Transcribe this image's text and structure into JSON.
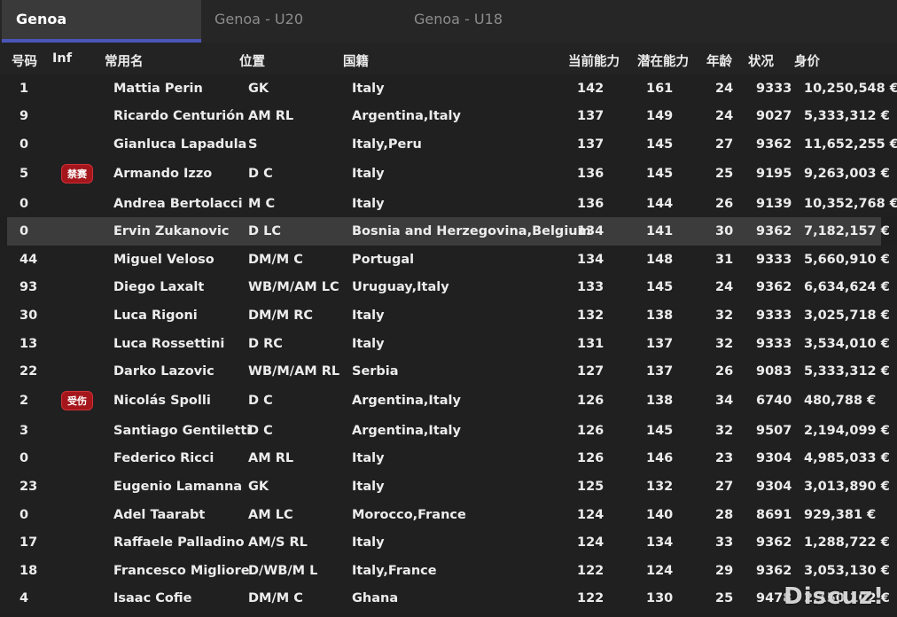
{
  "tabs": [
    {
      "label": "Genoa",
      "active": true
    },
    {
      "label": "Genoa - U20",
      "active": false
    },
    {
      "label": "Genoa - U18",
      "active": false
    }
  ],
  "columns": {
    "num": "号码",
    "inf": "Inf",
    "name": "常用名",
    "position": "位置",
    "nationality": "国籍",
    "current_ability": "当前能力",
    "potential_ability": "潜在能力",
    "age": "年龄",
    "condition": "状况",
    "value": "身价"
  },
  "players": [
    {
      "num": "1",
      "inf": "",
      "name": "Mattia Perin",
      "position": "GK",
      "nationality": "Italy",
      "ca": "142",
      "pa": "161",
      "age": "24",
      "condition": "9333",
      "value": "10,250,548 €"
    },
    {
      "num": "9",
      "inf": "",
      "name": "Ricardo Centurión",
      "position": "AM RL",
      "nationality": "Argentina,Italy",
      "ca": "137",
      "pa": "149",
      "age": "24",
      "condition": "9027",
      "value": "5,333,312 €"
    },
    {
      "num": "0",
      "inf": "",
      "name": "Gianluca Lapadula",
      "position": "S",
      "nationality": "Italy,Peru",
      "ca": "137",
      "pa": "145",
      "age": "27",
      "condition": "9362",
      "value": "11,652,255 €"
    },
    {
      "num": "5",
      "inf": "禁赛",
      "name": "Armando Izzo",
      "position": "D C",
      "nationality": "Italy",
      "ca": "136",
      "pa": "145",
      "age": "25",
      "condition": "9195",
      "value": "9,263,003 €"
    },
    {
      "num": "0",
      "inf": "",
      "name": "Andrea Bertolacci",
      "position": "M C",
      "nationality": "Italy",
      "ca": "136",
      "pa": "144",
      "age": "26",
      "condition": "9139",
      "value": "10,352,768 €"
    },
    {
      "num": "0",
      "inf": "",
      "name": "Ervin Zukanovic",
      "position": "D LC",
      "nationality": "Bosnia and Herzegovina,Belgium",
      "ca": "134",
      "pa": "141",
      "age": "30",
      "condition": "9362",
      "value": "7,182,157 €",
      "selected": true
    },
    {
      "num": "44",
      "inf": "",
      "name": "Miguel Veloso",
      "position": "DM/M C",
      "nationality": "Portugal",
      "ca": "134",
      "pa": "148",
      "age": "31",
      "condition": "9333",
      "value": "5,660,910 €"
    },
    {
      "num": "93",
      "inf": "",
      "name": "Diego Laxalt",
      "position": "WB/M/AM LC",
      "nationality": "Uruguay,Italy",
      "ca": "133",
      "pa": "145",
      "age": "24",
      "condition": "9362",
      "value": "6,634,624 €"
    },
    {
      "num": "30",
      "inf": "",
      "name": "Luca Rigoni",
      "position": "DM/M RC",
      "nationality": "Italy",
      "ca": "132",
      "pa": "138",
      "age": "32",
      "condition": "9333",
      "value": "3,025,718 €"
    },
    {
      "num": "13",
      "inf": "",
      "name": "Luca Rossettini",
      "position": "D RC",
      "nationality": "Italy",
      "ca": "131",
      "pa": "137",
      "age": "32",
      "condition": "9333",
      "value": "3,534,010 €"
    },
    {
      "num": "22",
      "inf": "",
      "name": "Darko Lazovic",
      "position": "WB/M/AM RL",
      "nationality": "Serbia",
      "ca": "127",
      "pa": "137",
      "age": "26",
      "condition": "9083",
      "value": "5,333,312 €"
    },
    {
      "num": "2",
      "inf": "受伤",
      "name": "Nicolás Spolli",
      "position": "D C",
      "nationality": "Argentina,Italy",
      "ca": "126",
      "pa": "138",
      "age": "34",
      "condition": "6740",
      "value": "480,788 €"
    },
    {
      "num": "3",
      "inf": "",
      "name": "Santiago Gentiletti",
      "position": "D C",
      "nationality": "Argentina,Italy",
      "ca": "126",
      "pa": "145",
      "age": "32",
      "condition": "9507",
      "value": "2,194,099 €"
    },
    {
      "num": "0",
      "inf": "",
      "name": "Federico Ricci",
      "position": "AM RL",
      "nationality": "Italy",
      "ca": "126",
      "pa": "146",
      "age": "23",
      "condition": "9304",
      "value": "4,985,033 €"
    },
    {
      "num": "23",
      "inf": "",
      "name": "Eugenio Lamanna",
      "position": "GK",
      "nationality": "Italy",
      "ca": "125",
      "pa": "132",
      "age": "27",
      "condition": "9304",
      "value": "3,013,890 €"
    },
    {
      "num": "0",
      "inf": "",
      "name": "Adel Taarabt",
      "position": "AM LC",
      "nationality": "Morocco,France",
      "ca": "124",
      "pa": "140",
      "age": "28",
      "condition": "8691",
      "value": "929,381 €"
    },
    {
      "num": "17",
      "inf": "",
      "name": "Raffaele Palladino",
      "position": "AM/S RL",
      "nationality": "Italy",
      "ca": "124",
      "pa": "134",
      "age": "33",
      "condition": "9362",
      "value": "1,288,722 €"
    },
    {
      "num": "18",
      "inf": "",
      "name": "Francesco Migliore",
      "position": "D/WB/M L",
      "nationality": "Italy,France",
      "ca": "122",
      "pa": "124",
      "age": "29",
      "condition": "9362",
      "value": "3,053,130 €"
    },
    {
      "num": "4",
      "inf": "",
      "name": "Isaac Cofie",
      "position": "DM/M C",
      "nationality": "Ghana",
      "ca": "122",
      "pa": "130",
      "age": "25",
      "condition": "9478",
      "value": "2,150,102 €"
    }
  ],
  "watermark": "Discuz!",
  "colors": {
    "background": "#1f1f1f",
    "tab_active": "#3a3a3a",
    "tab_underline": "#4a55b8",
    "badge": "#a4161b",
    "selected_row": "#3c3c3c"
  }
}
